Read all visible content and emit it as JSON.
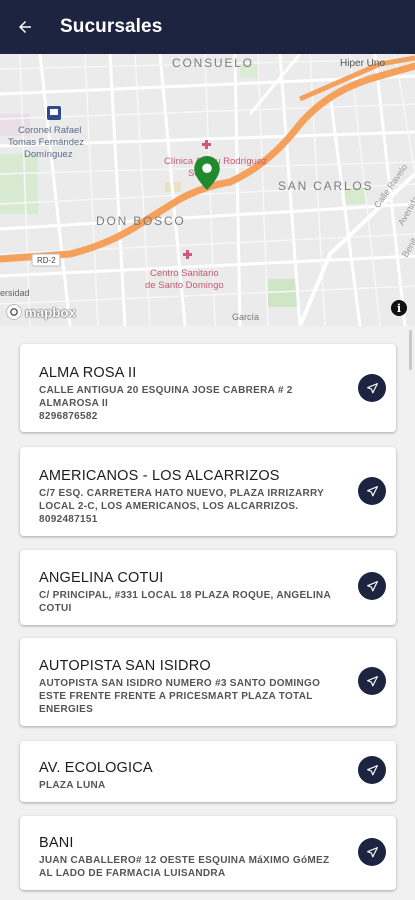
{
  "header": {
    "title": "Sucursales",
    "back_icon": "arrow-left-icon",
    "background": "#1c2440"
  },
  "map": {
    "labels": {
      "consuelo": "CONSUELO",
      "hiper_uno": "Hiper Uno",
      "metro_line1": "Coronel Rafael",
      "metro_line2": "Tomas Fernández",
      "metro_line3": "Domínguez",
      "clinic_line1": "Clínica Abreu Rodríguez",
      "clinic_line2": "Sosa",
      "san_carlos": "SAN CARLOS",
      "calle_ravelo": "Calle Ravelo",
      "don_bosco": "DON BOSCO",
      "centro_line1": "Centro Sanitario",
      "centro_line2": "de Santo Domingo",
      "universidad": "ersidad",
      "rd2": "RD-2",
      "garcia": "García",
      "avenida": "Avenida",
      "benito": "Benit"
    },
    "attribution": "mapbox",
    "info_icon": "info-icon",
    "pin_icon": "map-pin-icon",
    "pin_color": "#1f8a2e",
    "route_color": "#f5a15c"
  },
  "branches": [
    {
      "name": "ALMA ROSA II",
      "address": "CALLE ANTIGUA 20 ESQUINA JOSE CABRERA # 2 ALMAROSA II",
      "phone": "8296876582"
    },
    {
      "name": "AMERICANOS - LOS ALCARRIZOS",
      "address": "C/7 ESQ. CARRETERA HATO NUEVO, PLAZA IRRIZARRY LOCAL 2-C, LOS AMERICANOS, LOS ALCARRIZOS.",
      "phone": "8092487151"
    },
    {
      "name": "ANGELINA COTUI",
      "address": "C/ PRINCIPAL, #331 LOCAL 18 PLAZA ROQUE, ANGELINA COTUI",
      "phone": ""
    },
    {
      "name": "AUTOPISTA SAN ISIDRO",
      "address": "AUTOPISTA SAN ISIDRO NUMERO #3 SANTO DOMINGO ESTE FRENTE FRENTE A PRICESMART PLAZA TOTAL ENERGIES",
      "phone": ""
    },
    {
      "name": "AV. ECOLOGICA",
      "address": "PLAZA LUNA",
      "phone": ""
    },
    {
      "name": "BANI",
      "address": "JUAN CABALLERO# 12 OESTE ESQUINA MáXIMO GóMEZ AL LADO DE FARMACIA LUISANDRA",
      "phone": ""
    }
  ],
  "navigate_icon": "navigation-arrow-icon"
}
